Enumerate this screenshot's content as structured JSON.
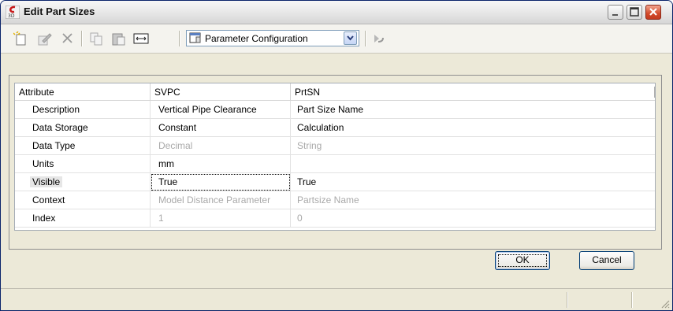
{
  "window": {
    "title": "Edit Part Sizes"
  },
  "toolbar": {
    "combo_value": "Parameter Configuration",
    "icons": [
      "new-row-icon",
      "edit-icon",
      "delete-icon",
      "copy-icon",
      "paste-icon",
      "resize-columns-icon",
      "parameter-configuration-icon",
      "dropdown-arrow-icon",
      "undo-icon"
    ]
  },
  "grid": {
    "columns": [
      "Attribute",
      "SVPC",
      "PrtSN"
    ],
    "rows": [
      {
        "attribute": "Description",
        "svpc": "Vertical Pipe Clearance",
        "prtsn": "Part Size Name"
      },
      {
        "attribute": "Data Storage",
        "svpc": "Constant",
        "prtsn": "Calculation"
      },
      {
        "attribute": "Data Type",
        "svpc": "Decimal",
        "prtsn": "String"
      },
      {
        "attribute": "Units",
        "svpc": "mm",
        "prtsn": ""
      },
      {
        "attribute": "Visible",
        "svpc": "True",
        "prtsn": "True"
      },
      {
        "attribute": "Context",
        "svpc": "Model Distance Parameter",
        "prtsn": "Partsize Name"
      },
      {
        "attribute": "Index",
        "svpc": "1",
        "prtsn": "0"
      }
    ]
  },
  "buttons": {
    "ok": "OK",
    "cancel": "Cancel"
  },
  "colors": {
    "title_close": "#d34a2a",
    "muted_text": "#a9a9a9",
    "frame_border": "#0a246a"
  }
}
